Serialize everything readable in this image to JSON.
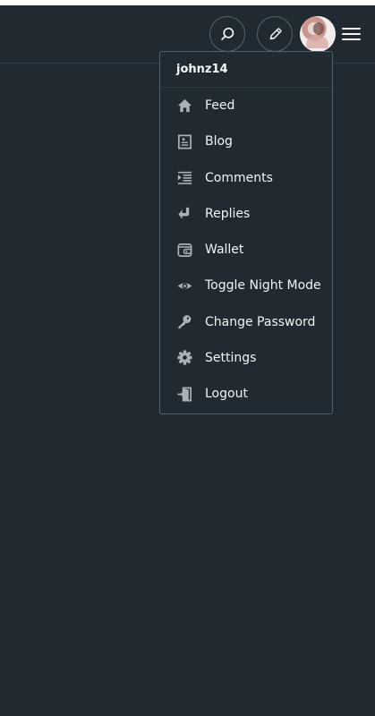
{
  "header": {
    "search_icon": "search-icon",
    "edit_icon": "pencil-icon",
    "avatar_icon": "avatar",
    "menu_icon": "hamburger-menu-icon"
  },
  "dropdown": {
    "username": "johnz14",
    "items": [
      {
        "label": "Feed",
        "icon": "home-icon"
      },
      {
        "label": "Blog",
        "icon": "blog-icon"
      },
      {
        "label": "Comments",
        "icon": "comments-icon"
      },
      {
        "label": "Replies",
        "icon": "reply-icon"
      },
      {
        "label": "Wallet",
        "icon": "wallet-icon"
      },
      {
        "label": "Toggle Night Mode",
        "icon": "eye-icon"
      },
      {
        "label": "Change Password",
        "icon": "key-icon"
      },
      {
        "label": "Settings",
        "icon": "gear-icon"
      },
      {
        "label": "Logout",
        "icon": "logout-icon"
      }
    ]
  },
  "colors": {
    "background": "#212a30",
    "text": "#f2f4f5",
    "border": "#55616b",
    "icon": "#a9b2b8"
  }
}
